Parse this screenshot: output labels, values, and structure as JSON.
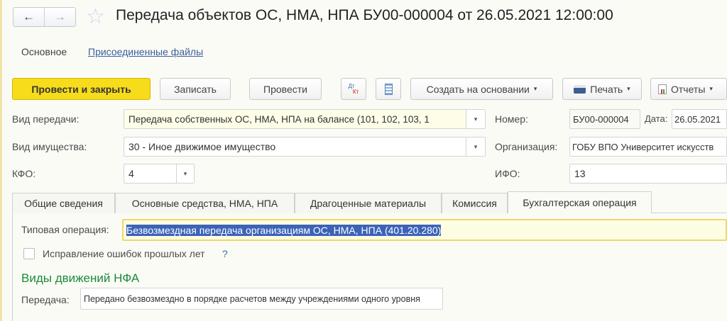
{
  "window": {
    "title": "Передача объектов ОС, НМА, НПА БУ00-000004 от 26.05.2021 12:00:00",
    "back": "←",
    "forward": "→",
    "star": "☆"
  },
  "sections": {
    "main": "Основное",
    "files": "Присоединенные файлы"
  },
  "toolbar": {
    "post_close": "Провести и закрыть",
    "save": "Записать",
    "post": "Провести",
    "dt": "Дт",
    "kt": "Кт",
    "create_based": "Создать на основании",
    "print": "Печать",
    "reports": "Отчеты",
    "caret": "▾"
  },
  "form": {
    "transfer_type": {
      "label": "Вид передачи:",
      "value": "Передача собственных ОС, НМА, НПА на балансе (101, 102, 103, 1"
    },
    "property_type": {
      "label": "Вид имущества:",
      "value": "30 - Иное движимое имущество"
    },
    "kfo": {
      "label": "КФО:",
      "value": "4"
    },
    "number": {
      "label": "Номер:",
      "value": "БУ00-000004"
    },
    "date": {
      "label": "Дата:",
      "value": "26.05.2021"
    },
    "organization": {
      "label": "Организация:",
      "value": "ГОБУ ВПО Университет искусств"
    },
    "ifo": {
      "label": "ИФО:",
      "value": "13"
    }
  },
  "tabs": [
    "Общие сведения",
    "Основные средства, НМА, НПА",
    "Драгоценные материалы",
    "Комиссия",
    "Бухгалтерская операция"
  ],
  "operation": {
    "label": "Типовая операция:",
    "value": "Безвозмездная передача организациям ОС, НМА, НПА (401.20.280)"
  },
  "errors_fix": {
    "label": "Исправление ошибок прошлых лет",
    "help": "?"
  },
  "movements": {
    "heading": "Виды движений НФА",
    "transfer_label": "Передача:",
    "transfer_value": "Передано безвозмездно в порядке расчетов между учреждениями одного уровня"
  }
}
